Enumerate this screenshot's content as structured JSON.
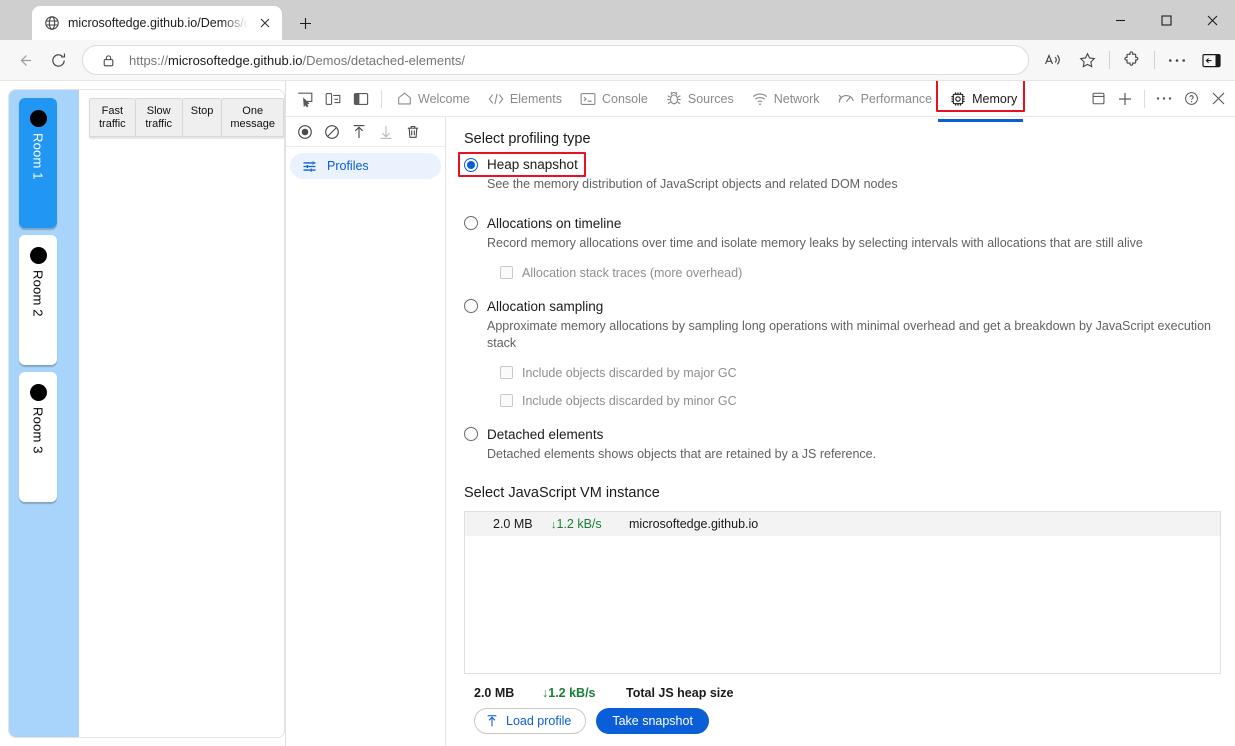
{
  "browser": {
    "tab": {
      "title": "microsoftedge.github.io/Demos/d",
      "favicon_icon": "globe-icon",
      "close_icon": "close-icon"
    },
    "new_tab_label": "+",
    "window_controls": {
      "minimize": "minimize-icon",
      "maximize": "maximize-icon",
      "close": "close-icon"
    },
    "nav": {
      "back_icon": "back-arrow-icon",
      "reload_icon": "reload-icon",
      "lock_icon": "lock-icon",
      "url_scheme": "https://",
      "url_host": "microsoftedge.github.io",
      "url_path": "/Demos/detached-elements/",
      "read_aloud_icon": "read-aloud-icon",
      "favorite_icon": "star-icon",
      "extensions_icon": "extensions-puzzle-icon",
      "settings_icon": "more-ellipsis-icon",
      "sidebar_icon": "sidebar-panel-icon"
    }
  },
  "page": {
    "rooms": [
      {
        "label": "Room 1",
        "active": true
      },
      {
        "label": "Room 2",
        "active": false
      },
      {
        "label": "Room 3",
        "active": false
      }
    ],
    "traffic_buttons": [
      "Fast traffic",
      "Slow traffic",
      "Stop",
      "One message"
    ]
  },
  "devtools": {
    "left_icons": [
      "inspect-element-icon",
      "device-toolbar-icon",
      "dock-side-icon"
    ],
    "tabs": [
      {
        "label": "Welcome",
        "icon": "home-icon",
        "selected": false
      },
      {
        "label": "Elements",
        "icon": "code-brackets-icon",
        "selected": false
      },
      {
        "label": "Console",
        "icon": "console-terminal-icon",
        "selected": false
      },
      {
        "label": "Sources",
        "icon": "bug-icon",
        "selected": false
      },
      {
        "label": "Network",
        "icon": "wifi-icon",
        "selected": false
      },
      {
        "label": "Performance",
        "icon": "performance-gauge-icon",
        "selected": false
      },
      {
        "label": "Memory",
        "icon": "memory-chip-icon",
        "selected": true
      }
    ],
    "right_icons": [
      "inspect-cookies-icon",
      "add-panel-plus-icon",
      "more-tools-ellipsis-icon",
      "help-question-icon",
      "close-devtools-icon"
    ],
    "memory_panel": {
      "toolbar_icons": [
        "record-icon",
        "clear-icon",
        "load-profile-icon",
        "save-profile-icon",
        "delete-profile-icon"
      ],
      "sidebar": {
        "profiles_label": "Profiles",
        "profiles_icon": "filters-sliders-icon"
      },
      "profiling_type_title": "Select profiling type",
      "options": [
        {
          "label": "Heap snapshot",
          "description": "See the memory distribution of JavaScript objects and related DOM nodes",
          "selected": true,
          "highlighted": true,
          "sub_options": []
        },
        {
          "label": "Allocations on timeline",
          "description": "Record memory allocations over time and isolate memory leaks by selecting intervals with allocations that are still alive",
          "selected": false,
          "highlighted": false,
          "sub_options": [
            {
              "label": "Allocation stack traces (more overhead)",
              "checked": false
            }
          ]
        },
        {
          "label": "Allocation sampling",
          "description": "Approximate memory allocations by sampling long operations with minimal overhead and get a breakdown by JavaScript execution stack",
          "selected": false,
          "highlighted": false,
          "sub_options": [
            {
              "label": "Include objects discarded by major GC",
              "checked": false
            },
            {
              "label": "Include objects discarded by minor GC",
              "checked": false
            }
          ]
        },
        {
          "label": "Detached elements",
          "description": "Detached elements shows objects that are retained by a JS reference.",
          "selected": false,
          "highlighted": false,
          "sub_options": []
        }
      ],
      "vm_instance_title": "Select JavaScript VM instance",
      "vm_instances": [
        {
          "size": "2.0 MB",
          "rate_arrow": "↓",
          "rate": "1.2 kB/s",
          "host": "microsoftedge.github.io"
        }
      ],
      "footer": {
        "total_size": "2.0 MB",
        "rate_arrow": "↓",
        "total_rate": "1.2 kB/s",
        "total_label": "Total JS heap size",
        "load_profile_label": "Load profile",
        "load_profile_icon": "upload-arrow-icon",
        "take_snapshot_label": "Take snapshot"
      }
    }
  },
  "colors": {
    "accent_blue": "#0a5ed7",
    "highlight_red": "#e81123",
    "room_active": "#2196f3",
    "rate_green": "#1a7f37",
    "rooms_bg": "#a8d4fb"
  }
}
